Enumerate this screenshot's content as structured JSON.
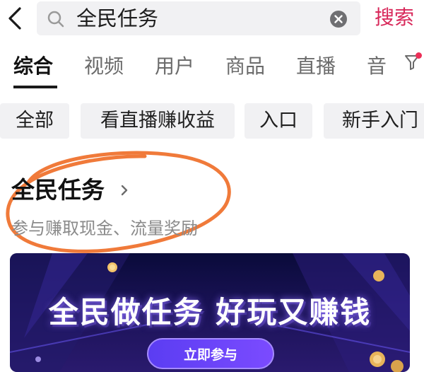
{
  "search": {
    "query": "全民任务",
    "button_label": "搜索"
  },
  "tabs": [
    {
      "label": "综合",
      "active": true
    },
    {
      "label": "视频"
    },
    {
      "label": "用户"
    },
    {
      "label": "商品"
    },
    {
      "label": "直播"
    },
    {
      "label": "音"
    }
  ],
  "chips": [
    {
      "label": "全部"
    },
    {
      "label": "看直播赚收益"
    },
    {
      "label": "入口"
    },
    {
      "label": "新手入门"
    }
  ],
  "task": {
    "title": "全民任务",
    "subtitle": "参与赚取现金、流量奖励"
  },
  "banner": {
    "title": "全民做任务 好玩又赚钱",
    "cta": "立即参与"
  },
  "colors": {
    "accent": "#d8285a",
    "marker": "#f07a3a",
    "banner_bg": "#1a1256"
  }
}
